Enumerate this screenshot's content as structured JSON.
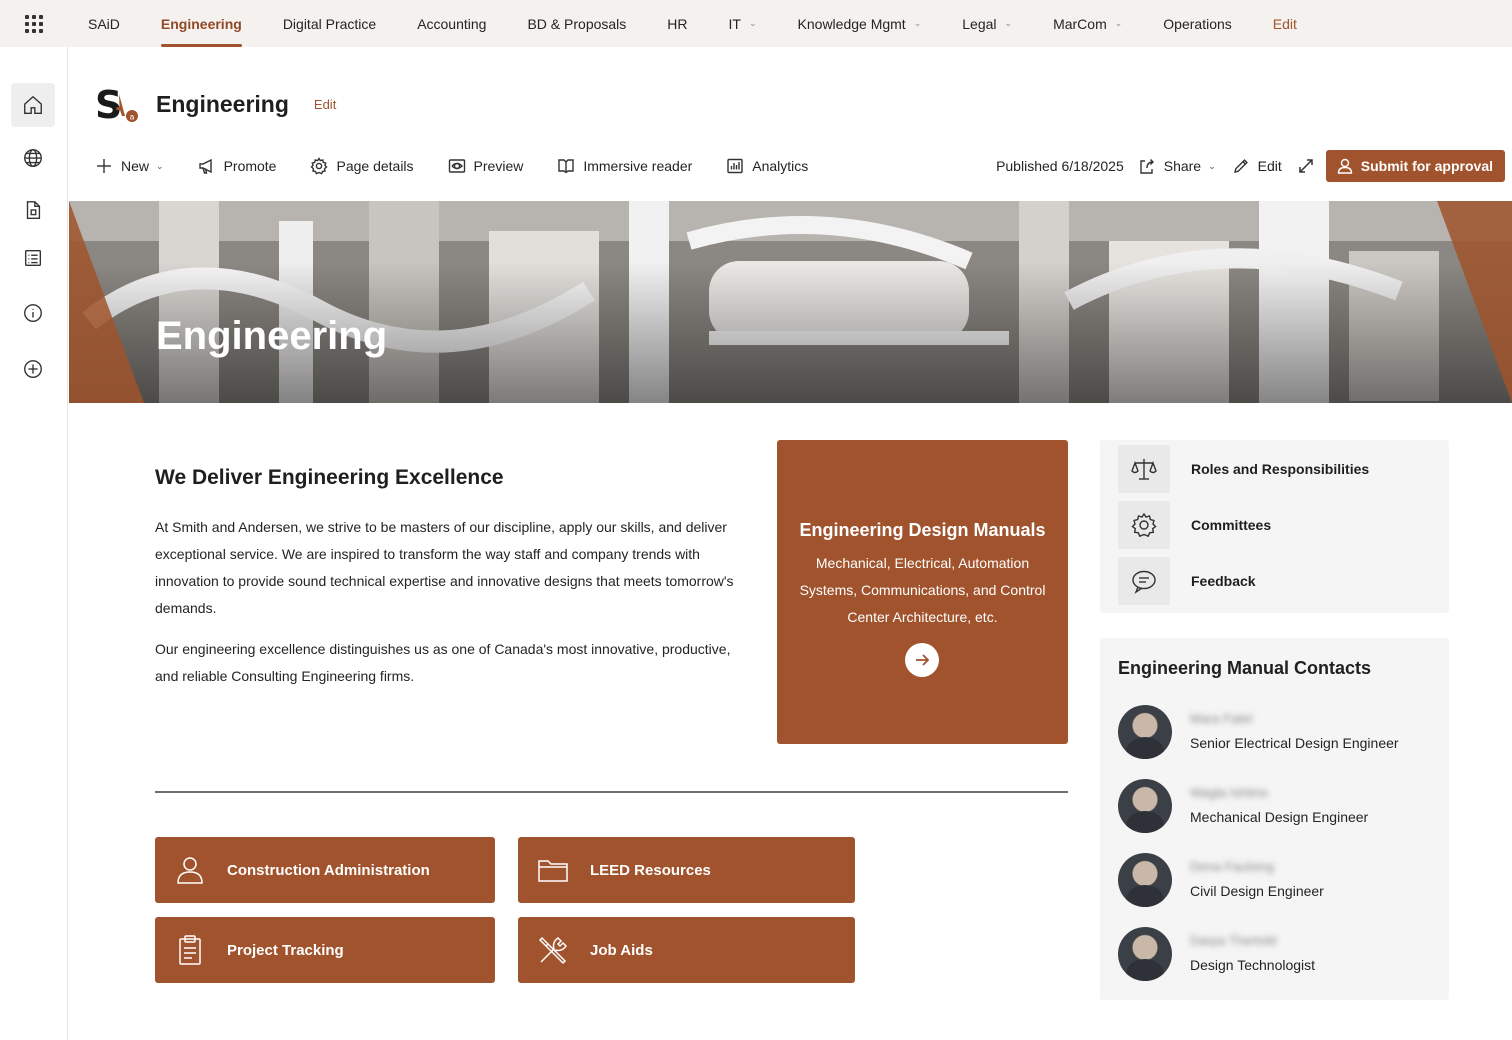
{
  "topnav": {
    "items": [
      {
        "label": "SAiD",
        "dropdown": false
      },
      {
        "label": "Engineering",
        "dropdown": false,
        "active": true
      },
      {
        "label": "Digital Practice",
        "dropdown": false
      },
      {
        "label": "Accounting",
        "dropdown": false
      },
      {
        "label": "BD & Proposals",
        "dropdown": false
      },
      {
        "label": "HR",
        "dropdown": false
      },
      {
        "label": "IT",
        "dropdown": true
      },
      {
        "label": "Knowledge Mgmt",
        "dropdown": true
      },
      {
        "label": "Legal",
        "dropdown": true
      },
      {
        "label": "MarCom",
        "dropdown": true
      },
      {
        "label": "Operations",
        "dropdown": false
      }
    ],
    "edit_label": "Edit"
  },
  "rail": {
    "icons": [
      "home-icon",
      "globe-icon",
      "document-icon",
      "list-icon",
      "info-icon",
      "add-icon"
    ]
  },
  "header": {
    "logo_text": "S",
    "title": "Engineering",
    "edit_label": "Edit"
  },
  "cmdbar": {
    "new_label": "New",
    "promote_label": "Promote",
    "page_details_label": "Page details",
    "preview_label": "Preview",
    "immersive_reader_label": "Immersive reader",
    "analytics_label": "Analytics",
    "published_label": "Published 6/18/2025",
    "share_label": "Share",
    "edit_label": "Edit",
    "submit_label": "Submit for approval"
  },
  "hero": {
    "title": "Engineering"
  },
  "intro": {
    "title": "We Deliver Engineering Excellence",
    "paragraph1": "At Smith and Andersen, we strive to be masters of our discipline, apply our skills, and deliver exceptional service. We are inspired to transform the way staff and company trends with innovation to provide sound technical expertise and innovative designs that meets tomorrow's demands.",
    "paragraph2": "Our engineering excellence distinguishes us as one of Canada's most innovative, productive, and reliable Consulting Engineering firms."
  },
  "feature": {
    "title": "Engineering Design Manuals",
    "description": "Mechanical, Electrical, Automation Systems, Communications, and Control Center Architecture, etc."
  },
  "quicklinks": [
    {
      "label": "Construction Administration",
      "icon": "person-icon"
    },
    {
      "label": "LEED Resources",
      "icon": "folder-icon"
    },
    {
      "label": "Project Tracking",
      "icon": "clipboard-icon"
    },
    {
      "label": "Job Aids",
      "icon": "tools-icon"
    }
  ],
  "right_links": [
    {
      "label": "Roles and Responsibilities",
      "icon": "scales-icon"
    },
    {
      "label": "Committees",
      "icon": "gear-icon"
    },
    {
      "label": "Feedback",
      "icon": "chat-icon"
    }
  ],
  "contacts": {
    "title": "Engineering Manual Contacts",
    "people": [
      {
        "name": "Mara Fatel",
        "role": "Senior Electrical Design Engineer"
      },
      {
        "name": "Wagla Ishtino",
        "role": "Mechanical Design Engineer"
      },
      {
        "name": "Dena Faulsing",
        "role": "Civil Design Engineer"
      },
      {
        "name": "Darpa Thertold",
        "role": "Design Technologist"
      }
    ]
  },
  "colors": {
    "accent": "#a0532c",
    "nav_bg": "#f5f1ee",
    "panel_bg": "#f5f5f5"
  }
}
